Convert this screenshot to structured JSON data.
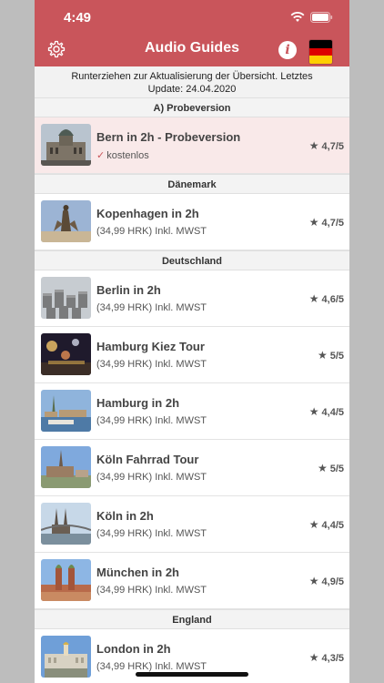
{
  "status": {
    "time": "4:49"
  },
  "header": {
    "title": "Audio Guides",
    "info_label": "i"
  },
  "notice": {
    "line1": "Runterziehen zur Aktualisierung der Übersicht. Letztes",
    "line2": "Update: 24.04.2020"
  },
  "colors": {
    "accent": "#c9555b",
    "highlight_row": "#f9e9e9",
    "section_bg": "#f3f3f3"
  },
  "sections": [
    {
      "title": "A) Probeversion",
      "items": [
        {
          "title": "Bern in 2h - Probeversion",
          "subtitle": "kostenlos",
          "rating": "4,7/5",
          "free": true,
          "thumb": "bern-parliament"
        }
      ]
    },
    {
      "title": "Dänemark",
      "items": [
        {
          "title": "Kopenhagen in 2h",
          "subtitle": "(34,99 HRK) Inkl. MWST",
          "rating": "4,7/5",
          "thumb": "copenhagen-fountain"
        }
      ]
    },
    {
      "title": "Deutschland",
      "items": [
        {
          "title": "Berlin in 2h",
          "subtitle": "(34,99 HRK) Inkl. MWST",
          "rating": "4,6/5",
          "thumb": "berlin-memorial"
        },
        {
          "title": "Hamburg Kiez Tour",
          "subtitle": "(34,99 HRK) Inkl. MWST",
          "rating": "5/5",
          "thumb": "hamburg-night"
        },
        {
          "title": "Hamburg in 2h",
          "subtitle": "(34,99 HRK) Inkl. MWST",
          "rating": "4,4/5",
          "thumb": "hamburg-harbour"
        },
        {
          "title": "Köln Fahrrad Tour",
          "subtitle": "(34,99 HRK) Inkl. MWST",
          "rating": "5/5",
          "thumb": "koeln-church"
        },
        {
          "title": "Köln in 2h",
          "subtitle": "(34,99 HRK) Inkl. MWST",
          "rating": "4,4/5",
          "thumb": "koeln-cathedral"
        },
        {
          "title": "München in 2h",
          "subtitle": "(34,99 HRK) Inkl. MWST",
          "rating": "4,9/5",
          "thumb": "muenchen-frauenkirche"
        }
      ]
    },
    {
      "title": "England",
      "items": [
        {
          "title": "London in 2h",
          "subtitle": "(34,99 HRK) Inkl. MWST",
          "rating": "4,3/5",
          "thumb": "london-palace"
        }
      ]
    }
  ]
}
